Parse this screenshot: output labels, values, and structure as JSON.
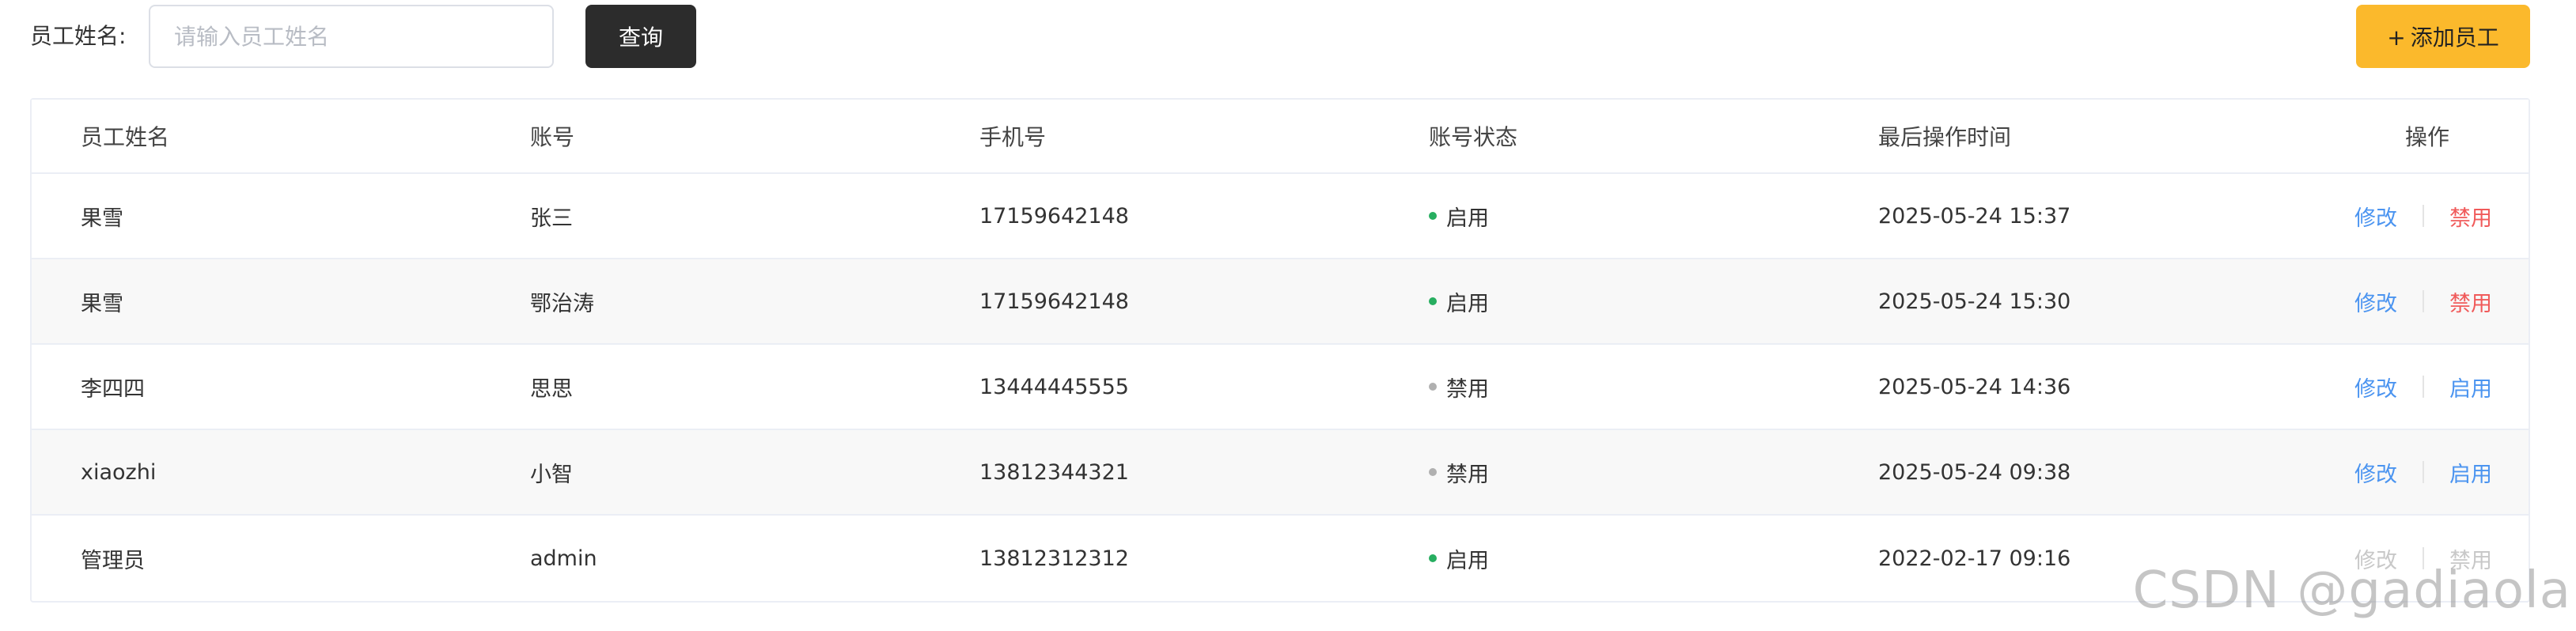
{
  "search": {
    "label": "员工姓名:",
    "placeholder": "请输入员工姓名",
    "value": ""
  },
  "buttons": {
    "query": "查询",
    "add_plus": "+",
    "add": "添加员工"
  },
  "table": {
    "headers": {
      "name": "员工姓名",
      "account": "账号",
      "phone": "手机号",
      "status": "账号状态",
      "time": "最后操作时间",
      "ops": "操作"
    },
    "rows": [
      {
        "name": "果雪",
        "account": "张三",
        "phone": "17159642148",
        "status": "启用",
        "time": "2025-05-24 15:37",
        "edit": "修改",
        "toggle": "禁用"
      },
      {
        "name": "果雪",
        "account": "鄂治涛",
        "phone": "17159642148",
        "status": "启用",
        "time": "2025-05-24 15:30",
        "edit": "修改",
        "toggle": "禁用"
      },
      {
        "name": "李四四",
        "account": "思思",
        "phone": "13444445555",
        "status": "禁用",
        "time": "2025-05-24 14:36",
        "edit": "修改",
        "toggle": "启用"
      },
      {
        "name": "xiaozhi",
        "account": "小智",
        "phone": "13812344321",
        "status": "禁用",
        "time": "2025-05-24 09:38",
        "edit": "修改",
        "toggle": "启用"
      },
      {
        "name": "管理员",
        "account": "admin",
        "phone": "13812312312",
        "status": "启用",
        "time": "2022-02-17 09:16",
        "edit": "修改",
        "toggle": "禁用"
      }
    ]
  },
  "colors": {
    "query_button": "#2c2c2c",
    "add_button": "#fbb92c",
    "enabled_dot": "#27ae60",
    "disabled_dot": "#b0b0b0",
    "link_blue": "#4b94f0",
    "danger_red": "#f05a5a"
  },
  "watermark": "CSDN @gadiaola"
}
